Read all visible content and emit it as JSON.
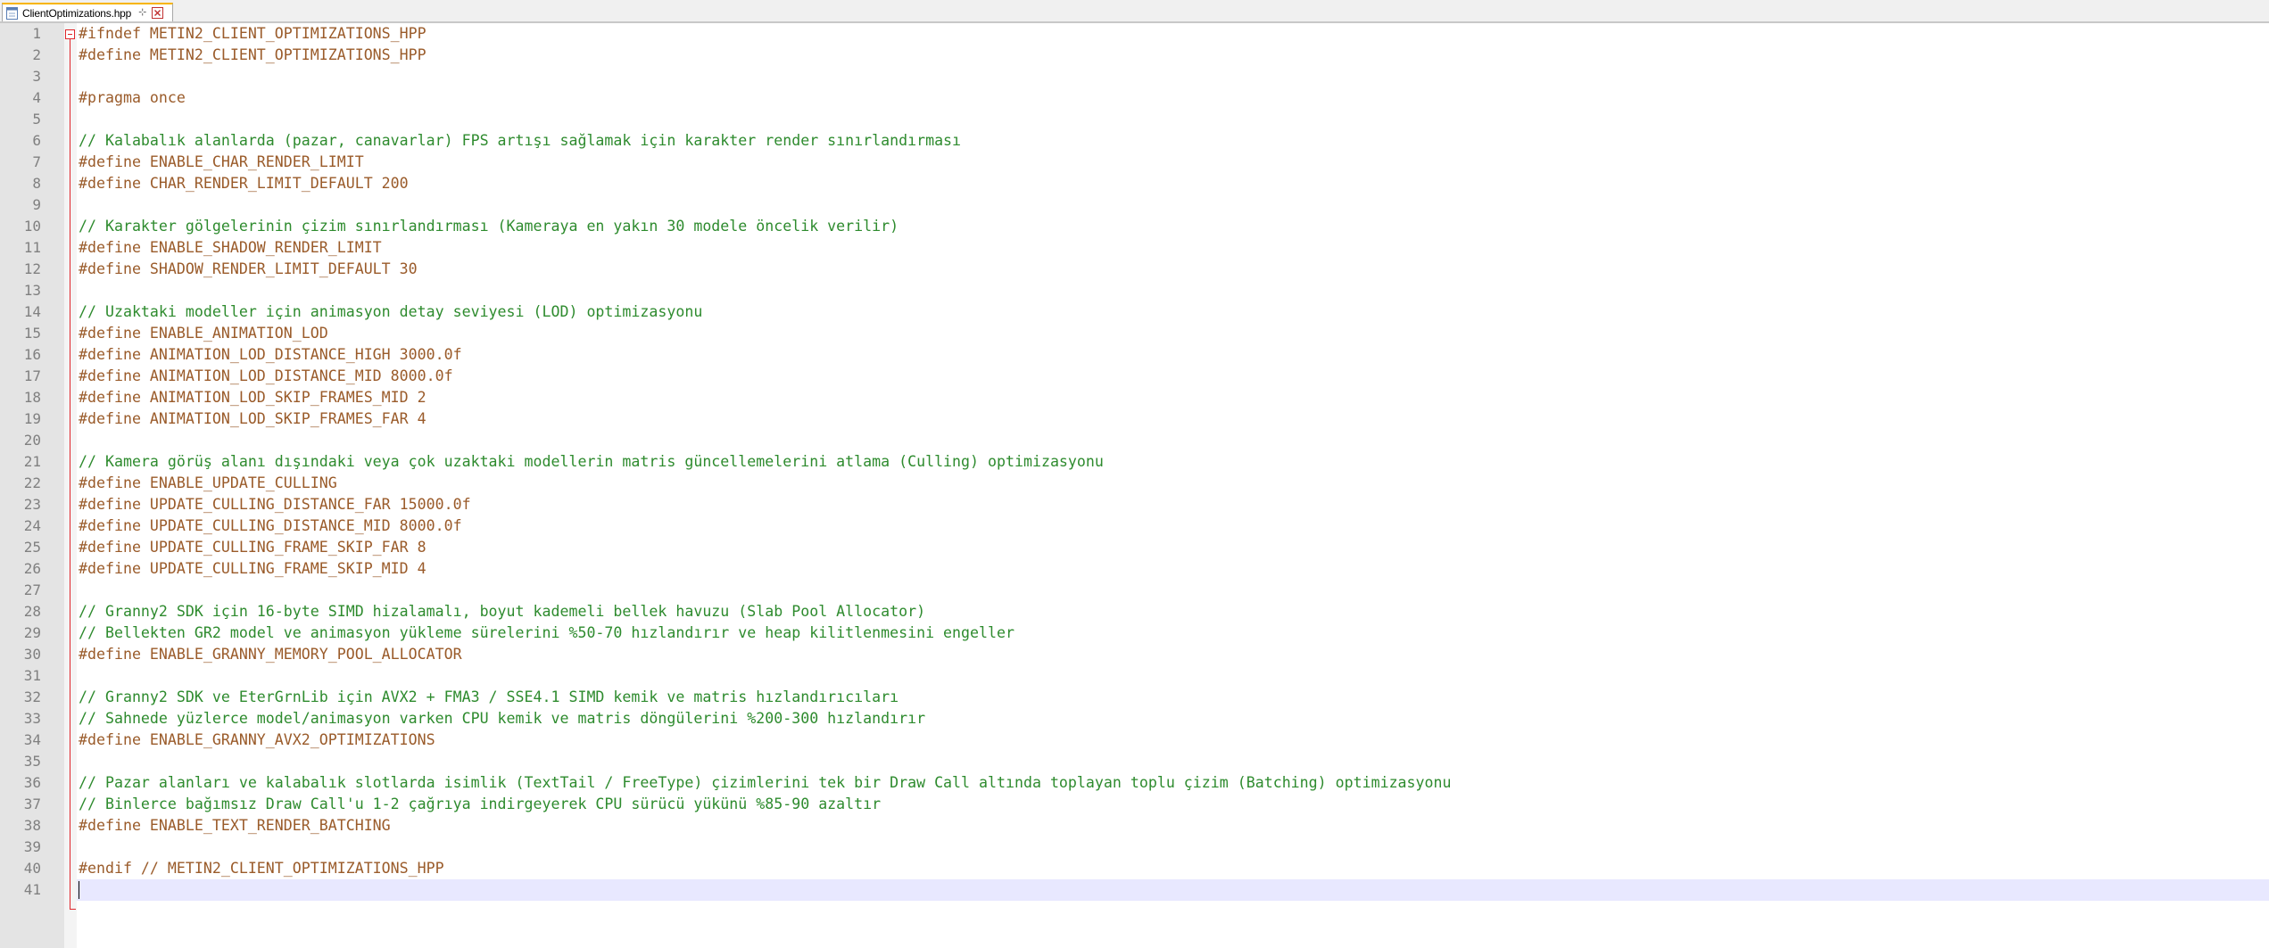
{
  "tab": {
    "title": "ClientOptimizations.hpp",
    "icon": "file-icon",
    "pin_icon": "pin-icon",
    "close_icon": "close-icon"
  },
  "editor": {
    "current_line": 41,
    "colors": {
      "preprocessor": "#9a5b2a",
      "comment": "#2e8b2e",
      "line_number": "#808080",
      "gutter": "#e4e4e4",
      "fold_marker": "#e0262b",
      "current_line_highlight": "#e8e8ff",
      "tab_accent": "#f7b500"
    },
    "lines": [
      {
        "n": "1",
        "text": "#ifndef METIN2_CLIENT_OPTIMIZATIONS_HPP",
        "kind": "pp"
      },
      {
        "n": "2",
        "text": "#define METIN2_CLIENT_OPTIMIZATIONS_HPP",
        "kind": "pp"
      },
      {
        "n": "3",
        "text": "",
        "kind": "pp"
      },
      {
        "n": "4",
        "text": "#pragma once",
        "kind": "pp"
      },
      {
        "n": "5",
        "text": "",
        "kind": "pp"
      },
      {
        "n": "6",
        "text": "// Kalabalık alanlarda (pazar, canavarlar) FPS artışı sağlamak için karakter render sınırlandırması",
        "kind": "cm"
      },
      {
        "n": "7",
        "text": "#define ENABLE_CHAR_RENDER_LIMIT",
        "kind": "pp"
      },
      {
        "n": "8",
        "text": "#define CHAR_RENDER_LIMIT_DEFAULT 200",
        "kind": "pp"
      },
      {
        "n": "9",
        "text": "",
        "kind": "pp"
      },
      {
        "n": "10",
        "text": "// Karakter gölgelerinin çizim sınırlandırması (Kameraya en yakın 30 modele öncelik verilir)",
        "kind": "cm"
      },
      {
        "n": "11",
        "text": "#define ENABLE_SHADOW_RENDER_LIMIT",
        "kind": "pp"
      },
      {
        "n": "12",
        "text": "#define SHADOW_RENDER_LIMIT_DEFAULT 30",
        "kind": "pp"
      },
      {
        "n": "13",
        "text": "",
        "kind": "pp"
      },
      {
        "n": "14",
        "text": "// Uzaktaki modeller için animasyon detay seviyesi (LOD) optimizasyonu",
        "kind": "cm"
      },
      {
        "n": "15",
        "text": "#define ENABLE_ANIMATION_LOD",
        "kind": "pp"
      },
      {
        "n": "16",
        "text": "#define ANIMATION_LOD_DISTANCE_HIGH 3000.0f",
        "kind": "pp"
      },
      {
        "n": "17",
        "text": "#define ANIMATION_LOD_DISTANCE_MID 8000.0f",
        "kind": "pp"
      },
      {
        "n": "18",
        "text": "#define ANIMATION_LOD_SKIP_FRAMES_MID 2",
        "kind": "pp"
      },
      {
        "n": "19",
        "text": "#define ANIMATION_LOD_SKIP_FRAMES_FAR 4",
        "kind": "pp"
      },
      {
        "n": "20",
        "text": "",
        "kind": "pp"
      },
      {
        "n": "21",
        "text": "// Kamera görüş alanı dışındaki veya çok uzaktaki modellerin matris güncellemelerini atlama (Culling) optimizasyonu",
        "kind": "cm"
      },
      {
        "n": "22",
        "text": "#define ENABLE_UPDATE_CULLING",
        "kind": "pp"
      },
      {
        "n": "23",
        "text": "#define UPDATE_CULLING_DISTANCE_FAR 15000.0f",
        "kind": "pp"
      },
      {
        "n": "24",
        "text": "#define UPDATE_CULLING_DISTANCE_MID 8000.0f",
        "kind": "pp"
      },
      {
        "n": "25",
        "text": "#define UPDATE_CULLING_FRAME_SKIP_FAR 8",
        "kind": "pp"
      },
      {
        "n": "26",
        "text": "#define UPDATE_CULLING_FRAME_SKIP_MID 4",
        "kind": "pp"
      },
      {
        "n": "27",
        "text": "",
        "kind": "pp"
      },
      {
        "n": "28",
        "text": "// Granny2 SDK için 16-byte SIMD hizalamalı, boyut kademeli bellek havuzu (Slab Pool Allocator)",
        "kind": "cm"
      },
      {
        "n": "29",
        "text": "// Bellekten GR2 model ve animasyon yükleme sürelerini %50-70 hızlandırır ve heap kilitlenmesini engeller",
        "kind": "cm"
      },
      {
        "n": "30",
        "text": "#define ENABLE_GRANNY_MEMORY_POOL_ALLOCATOR",
        "kind": "pp"
      },
      {
        "n": "31",
        "text": "",
        "kind": "pp"
      },
      {
        "n": "32",
        "text": "// Granny2 SDK ve EterGrnLib için AVX2 + FMA3 / SSE4.1 SIMD kemik ve matris hızlandırıcıları",
        "kind": "cm"
      },
      {
        "n": "33",
        "text": "// Sahnede yüzlerce model/animasyon varken CPU kemik ve matris döngülerini %200-300 hızlandırır",
        "kind": "cm"
      },
      {
        "n": "34",
        "text": "#define ENABLE_GRANNY_AVX2_OPTIMIZATIONS",
        "kind": "pp"
      },
      {
        "n": "35",
        "text": "",
        "kind": "pp"
      },
      {
        "n": "36",
        "text": "// Pazar alanları ve kalabalık slotlarda isimlik (TextTail / FreeType) çizimlerini tek bir Draw Call altında toplayan toplu çizim (Batching) optimizasyonu",
        "kind": "cm"
      },
      {
        "n": "37",
        "text": "// Binlerce bağımsız Draw Call'u 1-2 çağrıya indirgeyerek CPU sürücü yükünü %85-90 azaltır",
        "kind": "cm"
      },
      {
        "n": "38",
        "text": "#define ENABLE_TEXT_RENDER_BATCHING",
        "kind": "pp"
      },
      {
        "n": "39",
        "text": "",
        "kind": "pp"
      },
      {
        "n": "40",
        "text": "#endif // METIN2_CLIENT_OPTIMIZATIONS_HPP",
        "kind": "pp"
      },
      {
        "n": "41",
        "text": "",
        "kind": "pp"
      }
    ]
  }
}
